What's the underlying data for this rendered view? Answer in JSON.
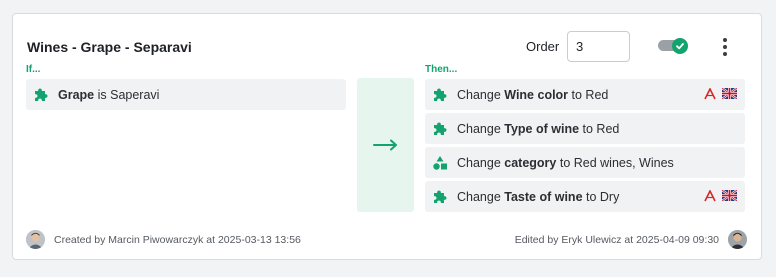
{
  "rule": {
    "title": "Wines - Grape - Separavi",
    "order_label": "Order",
    "order_value": "3",
    "enabled": true
  },
  "conditions": {
    "label": "If...",
    "items": [
      {
        "icon": "puzzle-icon",
        "attr": "Grape",
        "text": " is Saperavi"
      }
    ]
  },
  "actions": {
    "label": "Then...",
    "items": [
      {
        "icon": "puzzle-icon",
        "pre": "Change ",
        "attr": "Wine color",
        "post": " to Red",
        "badges": [
          "pdf-icon",
          "uk-flag-icon"
        ]
      },
      {
        "icon": "puzzle-icon",
        "pre": "Change ",
        "attr": "Type of wine",
        "post": " to Red",
        "badges": []
      },
      {
        "icon": "shapes-icon",
        "pre": "Change ",
        "attr": "category",
        "post": " to Red wines, Wines",
        "badges": []
      },
      {
        "icon": "puzzle-icon",
        "pre": "Change ",
        "attr": "Taste of wine",
        "post": " to Dry",
        "badges": [
          "pdf-icon",
          "uk-flag-icon"
        ]
      }
    ]
  },
  "footer": {
    "created": "Created by Marcin Piwowarczyk at 2025-03-13 13:56",
    "edited": "Edited by Eryk Ulewicz at 2025-04-09 09:30"
  },
  "colors": {
    "accent": "#13a36e",
    "arrow_bg": "#e6f6ee",
    "row_bg": "#f1f2f3"
  }
}
